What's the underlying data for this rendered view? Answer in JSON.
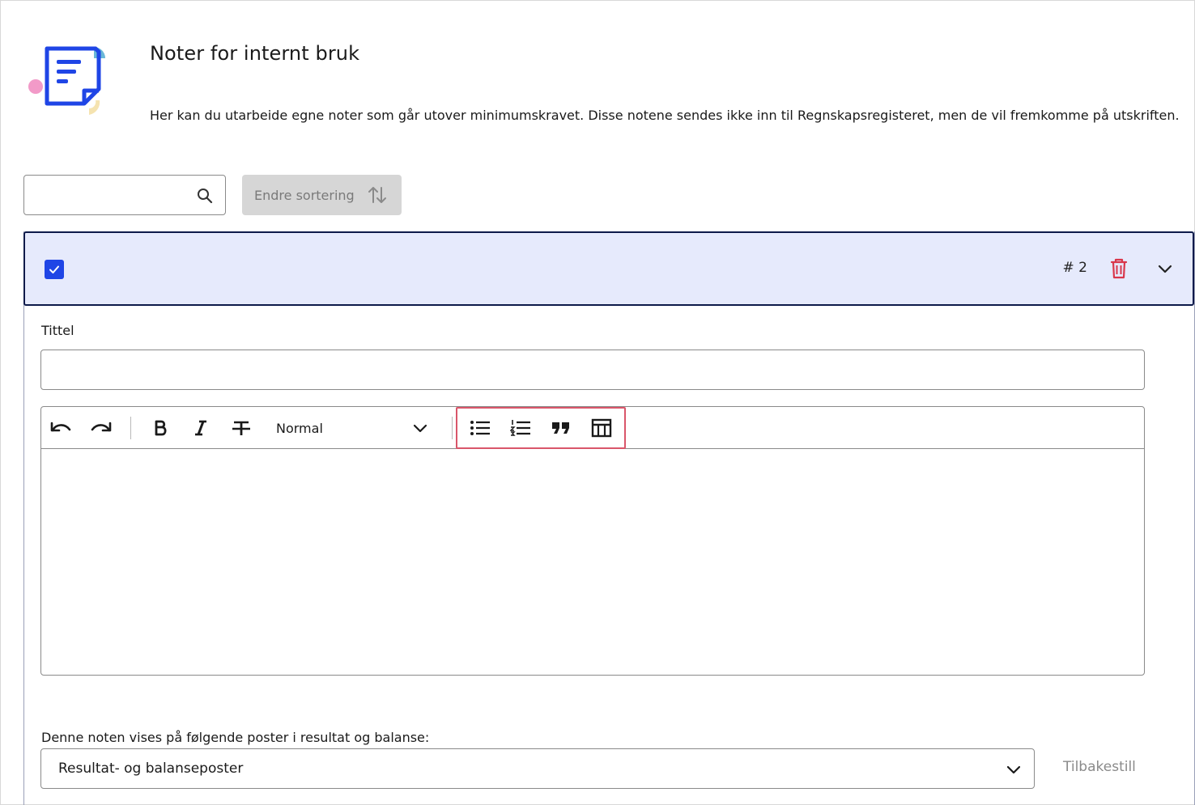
{
  "header": {
    "title": "Noter for internt bruk",
    "description": "Her kan du utarbeide egne noter som går utover minimumskravet. Disse notene sendes ikke inn til Regnskapsregisteret, men de vil fremkomme på utskriften.",
    "icon": "note-document-icon"
  },
  "controls": {
    "search_value": "",
    "search_icon": "search-icon",
    "sort_label": "Endre sortering",
    "sort_icon": "sort-arrows-icon"
  },
  "note": {
    "checked": true,
    "number_label": "# 2",
    "delete_icon": "trash-icon",
    "collapse_icon": "chevron-down-icon",
    "title_label": "Tittel",
    "title_value": ""
  },
  "editor": {
    "tools": [
      "undo-icon",
      "redo-icon",
      "bold-icon",
      "italic-icon",
      "strikethrough-icon",
      "bullet-list-icon",
      "numbered-list-icon",
      "blockquote-icon",
      "table-icon"
    ],
    "format_value": "Normal",
    "content": ""
  },
  "posts": {
    "label": "Denne noten vises på følgende poster i resultat og balanse:",
    "selected": "Resultat- og balanseposter",
    "reset_label": "Tilbakestill"
  },
  "colors": {
    "accent": "#1f45e6",
    "header_bg": "#e6eafc",
    "danger": "#d9374b",
    "highlight": "#d9566a"
  }
}
